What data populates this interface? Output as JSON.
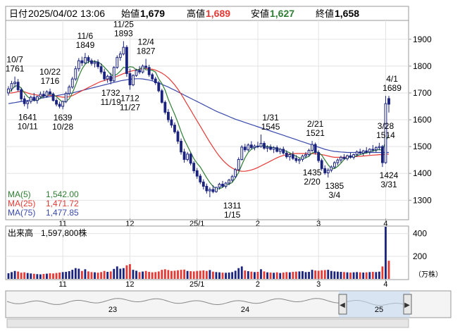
{
  "header": {
    "date_label": "日付",
    "datetime": "2025/04/02 13:06",
    "open_label": "始値",
    "open_value": "1,679",
    "high_label": "高値",
    "high_value": "1,689",
    "low_label": "安値",
    "low_value": "1,627",
    "close_label": "終値",
    "close_value": "1,658"
  },
  "colors": {
    "up": "#1a237e",
    "down": "#1a237e",
    "ma5": "#2e7d32",
    "ma25": "#e53935",
    "ma75": "#3949ab",
    "high": "#e53935",
    "low": "#2e7d32",
    "volume_up": "#1a237e",
    "volume_down": "#e53935"
  },
  "legend": [
    {
      "label": "MA(5)",
      "value": "1,542.00",
      "color": "#2e7d32"
    },
    {
      "label": "MA(25)",
      "value": "1,471.72",
      "color": "#e53935"
    },
    {
      "label": "MA(75)",
      "value": "1,477.85",
      "color": "#3949ab"
    }
  ],
  "volume_panel": {
    "label": "出来高",
    "value": "1,597,800株",
    "unit": "（万株）"
  },
  "navigator": {
    "year_labels": [
      "23",
      "24",
      "25"
    ]
  },
  "chart_data": {
    "type": "candlestick",
    "price_axis": {
      "ticks": [
        1300,
        1400,
        1500,
        1600,
        1700,
        1800,
        1900
      ],
      "range": [
        1230,
        1965
      ]
    },
    "volume_axis": {
      "ticks": [
        200,
        400
      ],
      "range": [
        0,
        460
      ]
    },
    "month_labels": [
      {
        "label": "11",
        "index": 17
      },
      {
        "label": "12",
        "index": 38
      },
      {
        "label": "25/1",
        "index": 59
      },
      {
        "label": "2",
        "index": 78
      },
      {
        "label": "3",
        "index": 97
      },
      {
        "label": "4",
        "index": 118
      }
    ],
    "annotations": [
      {
        "date": "10/7",
        "value": "1761",
        "index": 2,
        "price": 1761,
        "pos": "above"
      },
      {
        "date": "10/11",
        "value": "1641",
        "index": 6,
        "price": 1641,
        "pos": "below"
      },
      {
        "date": "10/22",
        "value": "1716",
        "index": 13,
        "price": 1716,
        "pos": "above"
      },
      {
        "date": "10/28",
        "value": "1639",
        "index": 17,
        "price": 1639,
        "pos": "below"
      },
      {
        "date": "11/6",
        "value": "1849",
        "index": 24,
        "price": 1849,
        "pos": "above"
      },
      {
        "date": "11/19",
        "value": "1732",
        "index": 32,
        "price": 1732,
        "pos": "below"
      },
      {
        "date": "11/25",
        "value": "1893",
        "index": 36,
        "price": 1893,
        "pos": "above"
      },
      {
        "date": "11/27",
        "value": "1712",
        "index": 38,
        "price": 1712,
        "pos": "below"
      },
      {
        "date": "12/4",
        "value": "1827",
        "index": 43,
        "price": 1827,
        "pos": "above"
      },
      {
        "date": "1/15",
        "value": "1311",
        "index": 70,
        "price": 1311,
        "pos": "below"
      },
      {
        "date": "1/31",
        "value": "1545",
        "index": 82,
        "price": 1545,
        "pos": "above"
      },
      {
        "date": "2/21",
        "value": "1521",
        "index": 96,
        "price": 1521,
        "pos": "above"
      },
      {
        "date": "2/20",
        "value": "1435",
        "index": 95,
        "price": 1435,
        "pos": "below"
      },
      {
        "date": "3/4",
        "value": "1385",
        "index": 102,
        "price": 1385,
        "pos": "below"
      },
      {
        "date": "3/28",
        "value": "1514",
        "index": 118,
        "price": 1514,
        "pos": "above"
      },
      {
        "date": "3/31",
        "value": "1424",
        "index": 119,
        "price": 1424,
        "pos": "below"
      },
      {
        "date": "4/1",
        "value": "1689",
        "index": 120,
        "price": 1689,
        "pos": "above"
      }
    ],
    "candles": [
      [
        1700,
        1725,
        1690,
        1715,
        50
      ],
      [
        1715,
        1745,
        1705,
        1735,
        60
      ],
      [
        1735,
        1761,
        1720,
        1740,
        70
      ],
      [
        1740,
        1752,
        1705,
        1712,
        65
      ],
      [
        1712,
        1720,
        1668,
        1678,
        55
      ],
      [
        1678,
        1690,
        1650,
        1660,
        58
      ],
      [
        1660,
        1672,
        1641,
        1668,
        52
      ],
      [
        1668,
        1690,
        1660,
        1684,
        48
      ],
      [
        1684,
        1700,
        1668,
        1672,
        45
      ],
      [
        1672,
        1690,
        1660,
        1686,
        42
      ],
      [
        1686,
        1705,
        1678,
        1695,
        40
      ],
      [
        1695,
        1708,
        1680,
        1688,
        44
      ],
      [
        1688,
        1710,
        1682,
        1704,
        46
      ],
      [
        1704,
        1716,
        1690,
        1696,
        50
      ],
      [
        1696,
        1702,
        1668,
        1672,
        48
      ],
      [
        1672,
        1680,
        1650,
        1658,
        52
      ],
      [
        1658,
        1668,
        1642,
        1650,
        56
      ],
      [
        1650,
        1672,
        1639,
        1668,
        60
      ],
      [
        1668,
        1705,
        1662,
        1698,
        62
      ],
      [
        1698,
        1730,
        1690,
        1722,
        68
      ],
      [
        1722,
        1760,
        1715,
        1752,
        80
      ],
      [
        1752,
        1800,
        1745,
        1790,
        95
      ],
      [
        1790,
        1830,
        1780,
        1820,
        90
      ],
      [
        1820,
        1835,
        1800,
        1812,
        70
      ],
      [
        1812,
        1849,
        1808,
        1832,
        85
      ],
      [
        1832,
        1840,
        1810,
        1820,
        66
      ],
      [
        1820,
        1828,
        1802,
        1810,
        60
      ],
      [
        1810,
        1822,
        1795,
        1815,
        58
      ],
      [
        1815,
        1825,
        1790,
        1798,
        55
      ],
      [
        1798,
        1810,
        1770,
        1778,
        60
      ],
      [
        1778,
        1790,
        1745,
        1752,
        70
      ],
      [
        1752,
        1768,
        1738,
        1762,
        62
      ],
      [
        1762,
        1775,
        1732,
        1745,
        66
      ],
      [
        1745,
        1800,
        1740,
        1795,
        88
      ],
      [
        1795,
        1840,
        1790,
        1832,
        110
      ],
      [
        1832,
        1855,
        1820,
        1845,
        90
      ],
      [
        1845,
        1893,
        1840,
        1870,
        95
      ],
      [
        1870,
        1878,
        1760,
        1772,
        120
      ],
      [
        1772,
        1790,
        1712,
        1730,
        130
      ],
      [
        1730,
        1770,
        1725,
        1765,
        80
      ],
      [
        1765,
        1790,
        1760,
        1784,
        72
      ],
      [
        1784,
        1800,
        1770,
        1778,
        60
      ],
      [
        1778,
        1806,
        1772,
        1800,
        65
      ],
      [
        1800,
        1827,
        1790,
        1795,
        70
      ],
      [
        1795,
        1805,
        1760,
        1768,
        62
      ],
      [
        1768,
        1775,
        1745,
        1752,
        58
      ],
      [
        1752,
        1760,
        1730,
        1738,
        60
      ],
      [
        1738,
        1745,
        1702,
        1708,
        66
      ],
      [
        1708,
        1715,
        1660,
        1665,
        80
      ],
      [
        1665,
        1672,
        1620,
        1628,
        85
      ],
      [
        1628,
        1640,
        1590,
        1600,
        78
      ],
      [
        1600,
        1612,
        1570,
        1580,
        70
      ],
      [
        1580,
        1590,
        1548,
        1555,
        72
      ],
      [
        1555,
        1562,
        1510,
        1520,
        76
      ],
      [
        1520,
        1530,
        1470,
        1480,
        80
      ],
      [
        1480,
        1492,
        1440,
        1452,
        82
      ],
      [
        1452,
        1480,
        1445,
        1472,
        70
      ],
      [
        1472,
        1478,
        1430,
        1438,
        68
      ],
      [
        1438,
        1446,
        1400,
        1410,
        66
      ],
      [
        1410,
        1420,
        1380,
        1390,
        70
      ],
      [
        1390,
        1398,
        1360,
        1368,
        72
      ],
      [
        1368,
        1378,
        1340,
        1352,
        75
      ],
      [
        1352,
        1362,
        1325,
        1335,
        70
      ],
      [
        1335,
        1348,
        1311,
        1340,
        78
      ],
      [
        1340,
        1356,
        1326,
        1332,
        64
      ],
      [
        1332,
        1350,
        1328,
        1348,
        60
      ],
      [
        1348,
        1365,
        1340,
        1360,
        58
      ],
      [
        1360,
        1372,
        1346,
        1352,
        55
      ],
      [
        1352,
        1368,
        1344,
        1364,
        54
      ],
      [
        1364,
        1380,
        1356,
        1375,
        56
      ],
      [
        1375,
        1395,
        1368,
        1388,
        60
      ],
      [
        1388,
        1420,
        1382,
        1414,
        72
      ],
      [
        1414,
        1460,
        1408,
        1452,
        95
      ],
      [
        1452,
        1505,
        1448,
        1498,
        110
      ],
      [
        1498,
        1510,
        1480,
        1488,
        74
      ],
      [
        1488,
        1512,
        1482,
        1506,
        68
      ],
      [
        1506,
        1520,
        1490,
        1496,
        64
      ],
      [
        1496,
        1508,
        1486,
        1502,
        60
      ],
      [
        1502,
        1518,
        1494,
        1500,
        62
      ],
      [
        1500,
        1545,
        1496,
        1512,
        85
      ],
      [
        1512,
        1520,
        1488,
        1494,
        66
      ],
      [
        1494,
        1505,
        1480,
        1498,
        58
      ],
      [
        1498,
        1508,
        1486,
        1490,
        56
      ],
      [
        1490,
        1502,
        1476,
        1496,
        54
      ],
      [
        1496,
        1504,
        1478,
        1482,
        58
      ],
      [
        1482,
        1496,
        1472,
        1490,
        52
      ],
      [
        1490,
        1500,
        1470,
        1476,
        56
      ],
      [
        1476,
        1486,
        1455,
        1462,
        60
      ],
      [
        1462,
        1475,
        1448,
        1470,
        58
      ],
      [
        1470,
        1482,
        1450,
        1456,
        62
      ],
      [
        1456,
        1468,
        1440,
        1448,
        64
      ],
      [
        1448,
        1458,
        1435,
        1452,
        66
      ],
      [
        1452,
        1470,
        1444,
        1465,
        68
      ],
      [
        1465,
        1480,
        1456,
        1470,
        60
      ],
      [
        1470,
        1492,
        1462,
        1486,
        62
      ],
      [
        1486,
        1521,
        1480,
        1508,
        80
      ],
      [
        1508,
        1515,
        1470,
        1478,
        74
      ],
      [
        1478,
        1486,
        1440,
        1448,
        72
      ],
      [
        1448,
        1456,
        1410,
        1418,
        76
      ],
      [
        1418,
        1430,
        1395,
        1402,
        78
      ],
      [
        1402,
        1420,
        1385,
        1412,
        80
      ],
      [
        1412,
        1430,
        1404,
        1424,
        70
      ],
      [
        1424,
        1446,
        1418,
        1440,
        66
      ],
      [
        1440,
        1456,
        1430,
        1450,
        64
      ],
      [
        1450,
        1466,
        1440,
        1460,
        62
      ],
      [
        1460,
        1472,
        1450,
        1455,
        60
      ],
      [
        1455,
        1470,
        1448,
        1466,
        58
      ],
      [
        1466,
        1478,
        1455,
        1460,
        56
      ],
      [
        1460,
        1474,
        1452,
        1470,
        58
      ],
      [
        1470,
        1486,
        1462,
        1480,
        60
      ],
      [
        1480,
        1492,
        1470,
        1476,
        58
      ],
      [
        1476,
        1488,
        1466,
        1484,
        56
      ],
      [
        1484,
        1498,
        1474,
        1480,
        58
      ],
      [
        1480,
        1494,
        1470,
        1490,
        60
      ],
      [
        1490,
        1506,
        1480,
        1488,
        62
      ],
      [
        1488,
        1502,
        1478,
        1496,
        60
      ],
      [
        1496,
        1514,
        1486,
        1500,
        64
      ],
      [
        1500,
        1506,
        1424,
        1440,
        110
      ],
      [
        1440,
        1689,
        1436,
        1660,
        460
      ],
      [
        1679,
        1689,
        1627,
        1658,
        160
      ]
    ],
    "ma5": [
      1700,
      1712,
      1725,
      1728,
      1718,
      1700,
      1686,
      1677,
      1672,
      1672,
      1680,
      1688,
      1692,
      1697,
      1694,
      1686,
      1675,
      1665,
      1668,
      1678,
      1700,
      1729,
      1762,
      1789,
      1807,
      1816,
      1818,
      1818,
      1815,
      1808,
      1796,
      1783,
      1768,
      1764,
      1770,
      1781,
      1796,
      1792,
      1798,
      1796,
      1786,
      1788,
      1798,
      1786,
      1786,
      1784,
      1778,
      1752,
      1735,
      1710,
      1676,
      1648,
      1620,
      1590,
      1556,
      1526,
      1502,
      1478,
      1455,
      1438,
      1424,
      1404,
      1384,
      1366,
      1352,
      1343,
      1343,
      1348,
      1358,
      1360,
      1366,
      1383,
      1403,
      1432,
      1458,
      1478,
      1490,
      1495,
      1500,
      1503,
      1502,
      1500,
      1499,
      1496,
      1493,
      1490,
      1487,
      1482,
      1477,
      1470,
      1464,
      1458,
      1456,
      1458,
      1464,
      1476,
      1480,
      1478,
      1468,
      1450,
      1432,
      1418,
      1418,
      1426,
      1438,
      1452,
      1460,
      1462,
      1462,
      1466,
      1470,
      1474,
      1476,
      1480,
      1484,
      1486,
      1490,
      1485,
      1520,
      1542
    ],
    "ma25": [
      1700,
      1700,
      1702,
      1705,
      1706,
      1704,
      1700,
      1696,
      1694,
      1692,
      1690,
      1690,
      1690,
      1691,
      1690,
      1688,
      1686,
      1684,
      1684,
      1686,
      1690,
      1696,
      1702,
      1708,
      1714,
      1720,
      1726,
      1732,
      1738,
      1743,
      1746,
      1750,
      1754,
      1758,
      1762,
      1767,
      1772,
      1776,
      1780,
      1783,
      1786,
      1788,
      1790,
      1791,
      1790,
      1788,
      1785,
      1780,
      1774,
      1766,
      1756,
      1744,
      1730,
      1714,
      1696,
      1676,
      1656,
      1636,
      1616,
      1596,
      1576,
      1556,
      1536,
      1516,
      1498,
      1480,
      1464,
      1450,
      1438,
      1428,
      1420,
      1414,
      1410,
      1408,
      1408,
      1410,
      1413,
      1417,
      1422,
      1428,
      1434,
      1440,
      1446,
      1452,
      1458,
      1463,
      1467,
      1470,
      1472,
      1474,
      1474,
      1474,
      1474,
      1474,
      1474,
      1474,
      1473,
      1472,
      1470,
      1468,
      1465,
      1462,
      1460,
      1460,
      1460,
      1460,
      1461,
      1462,
      1462,
      1463,
      1464,
      1465,
      1466,
      1467,
      1468,
      1469,
      1470,
      1470,
      1471,
      1472
    ],
    "ma75": [
      1660,
      1662,
      1664,
      1666,
      1668,
      1670,
      1672,
      1674,
      1676,
      1678,
      1680,
      1682,
      1684,
      1686,
      1688,
      1690,
      1692,
      1694,
      1696,
      1698,
      1700,
      1703,
      1706,
      1709,
      1712,
      1715,
      1718,
      1721,
      1724,
      1727,
      1730,
      1733,
      1736,
      1739,
      1742,
      1745,
      1747,
      1749,
      1751,
      1752,
      1753,
      1753,
      1752,
      1750,
      1748,
      1745,
      1741,
      1737,
      1732,
      1727,
      1722,
      1716,
      1710,
      1704,
      1698,
      1692,
      1686,
      1680,
      1674,
      1668,
      1662,
      1656,
      1650,
      1644,
      1638,
      1632,
      1627,
      1622,
      1617,
      1612,
      1607,
      1602,
      1598,
      1594,
      1590,
      1586,
      1582,
      1578,
      1574,
      1570,
      1566,
      1562,
      1558,
      1554,
      1550,
      1546,
      1542,
      1538,
      1534,
      1530,
      1526,
      1522,
      1518,
      1514,
      1510,
      1506,
      1502,
      1498,
      1494,
      1490,
      1487,
      1484,
      1482,
      1481,
      1480,
      1479,
      1478,
      1478,
      1478,
      1478,
      1478,
      1478,
      1478,
      1478,
      1478,
      1478,
      1478,
      1478,
      1478,
      1478
    ]
  }
}
